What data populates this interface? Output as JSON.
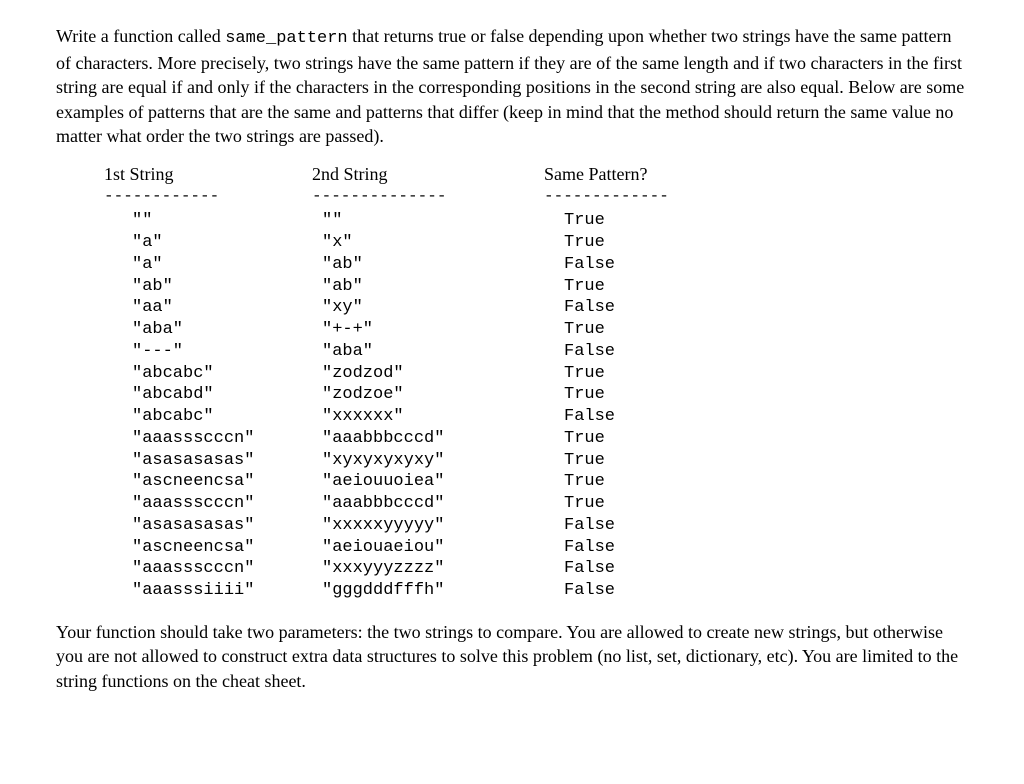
{
  "intro_html": "Write a function called <span class=\"mono\">same_pattern</span> that returns true or false depending upon whether two strings have the same pattern of characters.  More precisely, two strings have the same pattern if they are of the same length and if two characters in the first string are equal if and only if the characters in the corresponding positions in the second string are also equal.  Below are some examples of patterns that are the same and patterns that differ (keep in mind that the method should return the same value no matter what order the two strings are passed).",
  "headers": {
    "col1": "1st String",
    "col2": "2nd String",
    "col3": "Same Pattern?"
  },
  "dashes": {
    "col1": "------------",
    "col2": "--------------",
    "col3": "-------------"
  },
  "rows": [
    {
      "s1": "\"\"",
      "s2": "\"\"",
      "r": "True"
    },
    {
      "s1": "\"a\"",
      "s2": "\"x\"",
      "r": "True"
    },
    {
      "s1": "\"a\"",
      "s2": "\"ab\"",
      "r": "False"
    },
    {
      "s1": "\"ab\"",
      "s2": "\"ab\"",
      "r": "True"
    },
    {
      "s1": "\"aa\"",
      "s2": "\"xy\"",
      "r": "False"
    },
    {
      "s1": "\"aba\"",
      "s2": "\"+-+\"",
      "r": "True"
    },
    {
      "s1": "\"---\"",
      "s2": "\"aba\"",
      "r": "False"
    },
    {
      "s1": "\"abcabc\"",
      "s2": "\"zodzod\"",
      "r": "True"
    },
    {
      "s1": "\"abcabd\"",
      "s2": "\"zodzoe\"",
      "r": "True"
    },
    {
      "s1": "\"abcabc\"",
      "s2": "\"xxxxxx\"",
      "r": "False"
    },
    {
      "s1": "\"aaassscccn\"",
      "s2": "\"aaabbbcccd\"",
      "r": "True"
    },
    {
      "s1": "\"asasasasas\"",
      "s2": "\"xyxyxyxyxy\"",
      "r": "True"
    },
    {
      "s1": "\"ascneencsa\"",
      "s2": "\"aeiouuoiea\"",
      "r": "True"
    },
    {
      "s1": "\"aaassscccn\"",
      "s2": "\"aaabbbcccd\"",
      "r": "True"
    },
    {
      "s1": "\"asasasasas\"",
      "s2": "\"xxxxxyyyyy\"",
      "r": "False"
    },
    {
      "s1": "\"ascneencsa\"",
      "s2": "\"aeiouaeiou\"",
      "r": "False"
    },
    {
      "s1": "\"aaassscccn\"",
      "s2": "\"xxxyyyzzzz\"",
      "r": "False"
    },
    {
      "s1": "\"aaasssiiii\"",
      "s2": "\"gggdddfffh\"",
      "r": "False"
    }
  ],
  "outro": "Your function should take two parameters: the two strings to compare.  You are allowed to create new strings, but otherwise you are not allowed to construct extra data structures to solve this problem (no list, set, dictionary, etc).  You are limited to the string functions on the cheat sheet."
}
